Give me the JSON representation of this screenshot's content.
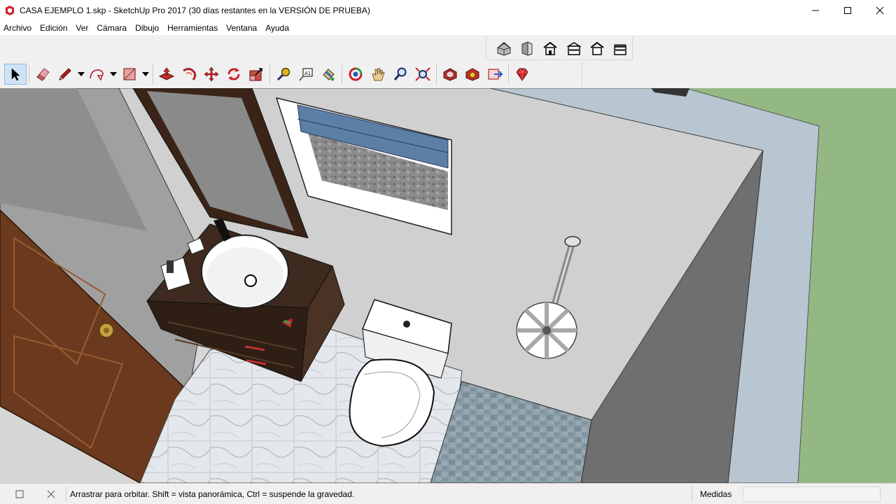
{
  "window": {
    "title": "CASA EJEMPLO 1.skp - SketchUp Pro 2017 (30 días restantes en la VERSIÓN DE PRUEBA)",
    "controls": [
      "minimize-icon",
      "maximize-icon",
      "close-icon"
    ]
  },
  "menu": {
    "items": [
      "Archivo",
      "Edición",
      "Ver",
      "Cámara",
      "Dibujo",
      "Herramientas",
      "Ventana",
      "Ayuda"
    ]
  },
  "views_toolbar": {
    "icons": [
      "iso-view-icon",
      "top-view-icon",
      "front-view-icon",
      "right-view-icon",
      "back-view-icon",
      "left-view-icon"
    ]
  },
  "main_toolbar": {
    "icons": [
      "select-arrow-icon",
      "eraser-icon",
      "pencil-line-icon",
      "arc-icon",
      "rectangle-icon",
      "push-pull-icon",
      "follow-me-icon",
      "move-icon",
      "rotate-icon",
      "scale-icon",
      "tape-measure-icon",
      "text-label-icon",
      "paint-bucket-icon",
      "orbit-icon",
      "pan-hand-icon",
      "zoom-icon",
      "zoom-extents-icon",
      "3d-warehouse-icon",
      "extension-warehouse-icon",
      "layout-send-icon",
      "ruby-icon"
    ],
    "active": "select-arrow-icon"
  },
  "status_bar": {
    "hint": "Arrastrar para orbitar. Shift = vista panorámica, Ctrl = suspende la gravedad.",
    "measurements_label": "Medidas",
    "measurements_value": ""
  },
  "colors": {
    "chrome": "#f0f0f0",
    "wall_gray": "#c9c9c9",
    "floor_light": "#d6d6d6",
    "door_brown": "#6b3a1e",
    "vanity_dark": "#3e2a1e",
    "window_blue": "#5c7fa6",
    "exterior_green": "#93b884",
    "exterior_wall": "#b7c6d0"
  }
}
